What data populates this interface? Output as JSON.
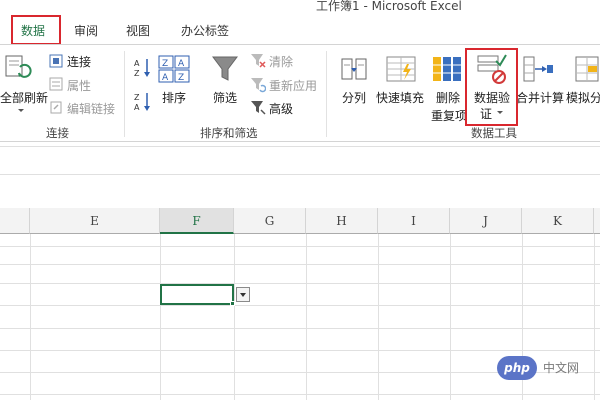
{
  "window": {
    "title": "工作簿1 - Microsoft Excel"
  },
  "tabs": [
    {
      "label": "数据",
      "active": true
    },
    {
      "label": "审阅",
      "active": false
    },
    {
      "label": "视图",
      "active": false
    },
    {
      "label": "办公标签",
      "active": false
    }
  ],
  "ribbon": {
    "groups": {
      "connections": {
        "label": "连接",
        "refresh_all": "全部刷新",
        "connections": "连接",
        "properties": "属性",
        "edit_links": "编辑链接"
      },
      "sort_filter": {
        "label": "排序和筛选",
        "sort": "排序",
        "filter": "筛选",
        "clear": "清除",
        "reapply": "重新应用",
        "advanced": "高级"
      },
      "data_tools": {
        "label": "数据工具",
        "text_to_columns": "分列",
        "flash_fill": "快速填充",
        "remove_duplicates_line1": "删除",
        "remove_duplicates_line2": "重复项",
        "data_validation_line1": "数据验",
        "data_validation_line2": "证",
        "consolidate": "合并计算",
        "what_if": "模拟分"
      }
    }
  },
  "grid": {
    "columns": [
      "E",
      "F",
      "G",
      "H",
      "I",
      "J",
      "K"
    ],
    "selected_column": "F"
  },
  "watermark": {
    "badge": "php",
    "text": "中文网"
  },
  "colors": {
    "accent": "#217346",
    "highlight": "#d9272e"
  }
}
